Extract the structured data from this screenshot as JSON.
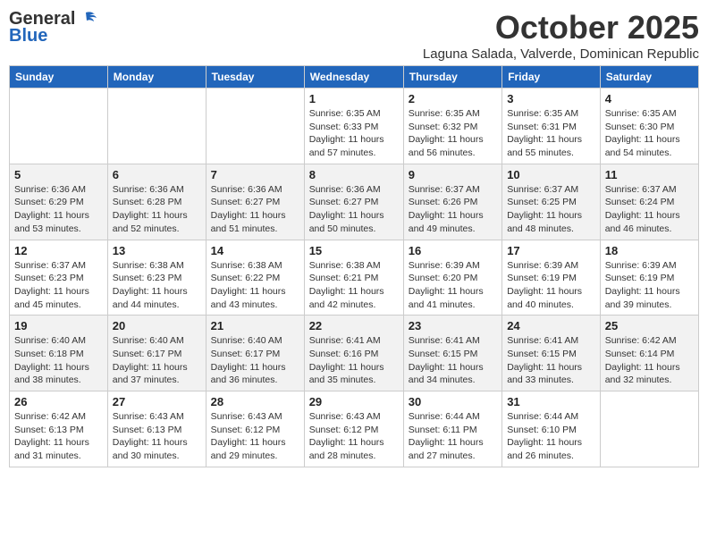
{
  "logo": {
    "general": "General",
    "blue": "Blue"
  },
  "header": {
    "month": "October 2025",
    "location": "Laguna Salada, Valverde, Dominican Republic"
  },
  "days_of_week": [
    "Sunday",
    "Monday",
    "Tuesday",
    "Wednesday",
    "Thursday",
    "Friday",
    "Saturday"
  ],
  "weeks": [
    {
      "cells": [
        {
          "day": "",
          "info": ""
        },
        {
          "day": "",
          "info": ""
        },
        {
          "day": "",
          "info": ""
        },
        {
          "day": "1",
          "info": "Sunrise: 6:35 AM\nSunset: 6:33 PM\nDaylight: 11 hours and 57 minutes."
        },
        {
          "day": "2",
          "info": "Sunrise: 6:35 AM\nSunset: 6:32 PM\nDaylight: 11 hours and 56 minutes."
        },
        {
          "day": "3",
          "info": "Sunrise: 6:35 AM\nSunset: 6:31 PM\nDaylight: 11 hours and 55 minutes."
        },
        {
          "day": "4",
          "info": "Sunrise: 6:35 AM\nSunset: 6:30 PM\nDaylight: 11 hours and 54 minutes."
        }
      ]
    },
    {
      "cells": [
        {
          "day": "5",
          "info": "Sunrise: 6:36 AM\nSunset: 6:29 PM\nDaylight: 11 hours and 53 minutes."
        },
        {
          "day": "6",
          "info": "Sunrise: 6:36 AM\nSunset: 6:28 PM\nDaylight: 11 hours and 52 minutes."
        },
        {
          "day": "7",
          "info": "Sunrise: 6:36 AM\nSunset: 6:27 PM\nDaylight: 11 hours and 51 minutes."
        },
        {
          "day": "8",
          "info": "Sunrise: 6:36 AM\nSunset: 6:27 PM\nDaylight: 11 hours and 50 minutes."
        },
        {
          "day": "9",
          "info": "Sunrise: 6:37 AM\nSunset: 6:26 PM\nDaylight: 11 hours and 49 minutes."
        },
        {
          "day": "10",
          "info": "Sunrise: 6:37 AM\nSunset: 6:25 PM\nDaylight: 11 hours and 48 minutes."
        },
        {
          "day": "11",
          "info": "Sunrise: 6:37 AM\nSunset: 6:24 PM\nDaylight: 11 hours and 46 minutes."
        }
      ]
    },
    {
      "cells": [
        {
          "day": "12",
          "info": "Sunrise: 6:37 AM\nSunset: 6:23 PM\nDaylight: 11 hours and 45 minutes."
        },
        {
          "day": "13",
          "info": "Sunrise: 6:38 AM\nSunset: 6:23 PM\nDaylight: 11 hours and 44 minutes."
        },
        {
          "day": "14",
          "info": "Sunrise: 6:38 AM\nSunset: 6:22 PM\nDaylight: 11 hours and 43 minutes."
        },
        {
          "day": "15",
          "info": "Sunrise: 6:38 AM\nSunset: 6:21 PM\nDaylight: 11 hours and 42 minutes."
        },
        {
          "day": "16",
          "info": "Sunrise: 6:39 AM\nSunset: 6:20 PM\nDaylight: 11 hours and 41 minutes."
        },
        {
          "day": "17",
          "info": "Sunrise: 6:39 AM\nSunset: 6:19 PM\nDaylight: 11 hours and 40 minutes."
        },
        {
          "day": "18",
          "info": "Sunrise: 6:39 AM\nSunset: 6:19 PM\nDaylight: 11 hours and 39 minutes."
        }
      ]
    },
    {
      "cells": [
        {
          "day": "19",
          "info": "Sunrise: 6:40 AM\nSunset: 6:18 PM\nDaylight: 11 hours and 38 minutes."
        },
        {
          "day": "20",
          "info": "Sunrise: 6:40 AM\nSunset: 6:17 PM\nDaylight: 11 hours and 37 minutes."
        },
        {
          "day": "21",
          "info": "Sunrise: 6:40 AM\nSunset: 6:17 PM\nDaylight: 11 hours and 36 minutes."
        },
        {
          "day": "22",
          "info": "Sunrise: 6:41 AM\nSunset: 6:16 PM\nDaylight: 11 hours and 35 minutes."
        },
        {
          "day": "23",
          "info": "Sunrise: 6:41 AM\nSunset: 6:15 PM\nDaylight: 11 hours and 34 minutes."
        },
        {
          "day": "24",
          "info": "Sunrise: 6:41 AM\nSunset: 6:15 PM\nDaylight: 11 hours and 33 minutes."
        },
        {
          "day": "25",
          "info": "Sunrise: 6:42 AM\nSunset: 6:14 PM\nDaylight: 11 hours and 32 minutes."
        }
      ]
    },
    {
      "cells": [
        {
          "day": "26",
          "info": "Sunrise: 6:42 AM\nSunset: 6:13 PM\nDaylight: 11 hours and 31 minutes."
        },
        {
          "day": "27",
          "info": "Sunrise: 6:43 AM\nSunset: 6:13 PM\nDaylight: 11 hours and 30 minutes."
        },
        {
          "day": "28",
          "info": "Sunrise: 6:43 AM\nSunset: 6:12 PM\nDaylight: 11 hours and 29 minutes."
        },
        {
          "day": "29",
          "info": "Sunrise: 6:43 AM\nSunset: 6:12 PM\nDaylight: 11 hours and 28 minutes."
        },
        {
          "day": "30",
          "info": "Sunrise: 6:44 AM\nSunset: 6:11 PM\nDaylight: 11 hours and 27 minutes."
        },
        {
          "day": "31",
          "info": "Sunrise: 6:44 AM\nSunset: 6:10 PM\nDaylight: 11 hours and 26 minutes."
        },
        {
          "day": "",
          "info": ""
        }
      ]
    }
  ]
}
